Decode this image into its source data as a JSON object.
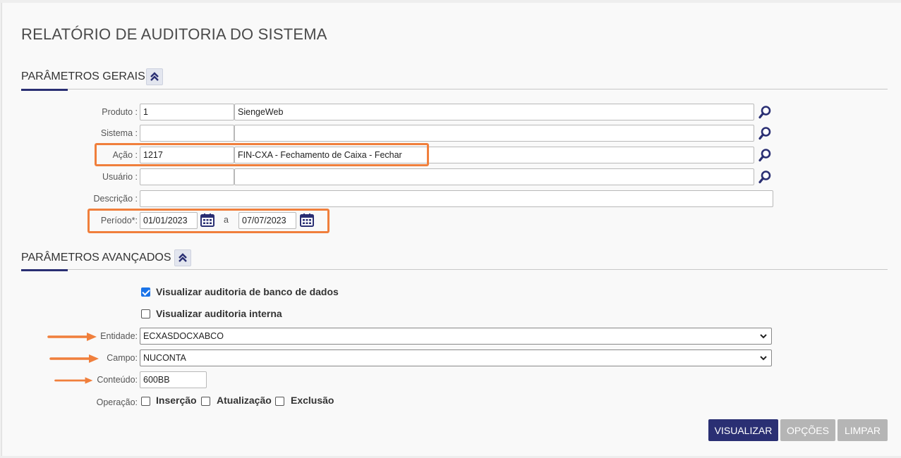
{
  "title": "RELATÓRIO DE AUDITORIA DO SISTEMA",
  "general": {
    "title": "PARÂMETROS GERAIS",
    "produto": {
      "label": "Produto :",
      "code": "1",
      "name": "SiengeWeb"
    },
    "sistema": {
      "label": "Sistema :",
      "code": "",
      "name": ""
    },
    "acao": {
      "label": "Ação :",
      "code": "1217",
      "name": "FIN-CXA - Fechamento de Caixa - Fechar"
    },
    "usuario": {
      "label": "Usuário :",
      "code": "",
      "name": ""
    },
    "descricao": {
      "label": "Descrição :",
      "value": ""
    },
    "periodo": {
      "label": "Período*:",
      "start": "01/01/2023",
      "sep": "a",
      "end": "07/07/2023"
    }
  },
  "advanced": {
    "title": "PARÂMETROS AVANÇADOS",
    "audit_db": {
      "label": "Visualizar auditoria de banco de dados",
      "checked": true
    },
    "audit_internal": {
      "label": "Visualizar auditoria interna",
      "checked": false
    },
    "entidade": {
      "label": "Entidade:",
      "value": "ECXASDOCXABCO"
    },
    "campo": {
      "label": "Campo:",
      "value": "NUCONTA"
    },
    "conteudo": {
      "label": "Conteúdo:",
      "value": "600BB"
    },
    "operacao": {
      "label": "Operação:",
      "insercao": "Inserção",
      "atualizacao": "Atualização",
      "exclusao": "Exclusão"
    }
  },
  "buttons": {
    "visualizar": "VISUALIZAR",
    "opcoes": "OPÇÕES",
    "limpar": "LIMPAR"
  },
  "colors": {
    "primary": "#2a2f73",
    "highlight": "#f07f3c",
    "disabled": "#b5b5b5"
  },
  "icons": [
    "chevron-double-up-icon",
    "magnifier-icon",
    "calendar-icon",
    "chevron-down-icon",
    "arrow-right-icon"
  ]
}
